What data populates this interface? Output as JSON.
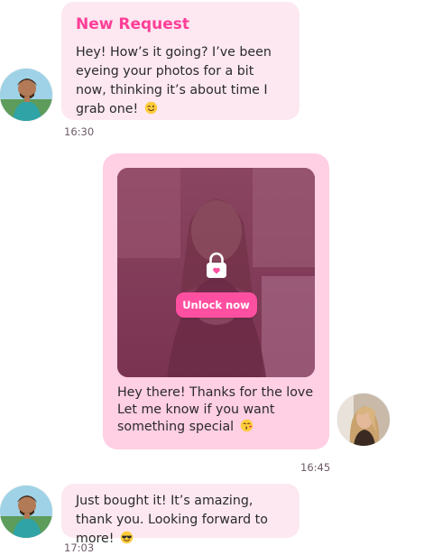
{
  "messages": {
    "first": {
      "title": "New Request",
      "text": "Hey! How’s it going? I’ve been eyeing your photos for a bit now, thinking it’s about time I grab one!",
      "emoji": "winking-face",
      "time": "16:30"
    },
    "second": {
      "button_label": "Unlock now",
      "lock_icon": "lock-heart-icon",
      "text": "Hey there! Thanks for the love Let me know if you want something special",
      "emoji": "face-blowing-kiss",
      "time": "16:45"
    },
    "third": {
      "text": "Just bought it! It’s amazing, thank you. Looking forward to more!",
      "emoji": "smiling-face-with-sunglasses",
      "time": "17:03"
    }
  },
  "colors": {
    "incoming_bubble": "#fde8f1",
    "outgoing_bubble": "#ffcfe4",
    "accent": "#ff4fa0",
    "title": "#ff3f98"
  }
}
